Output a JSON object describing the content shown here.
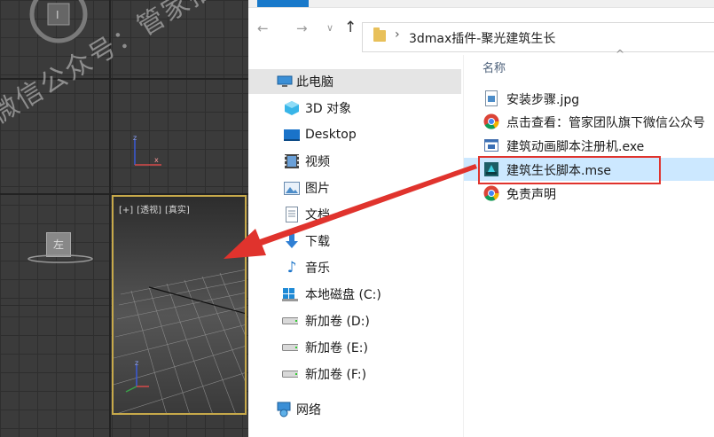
{
  "watermark": "微信公众号：管家插件",
  "viewport": {
    "label_plus": "[+]",
    "label_view": "[透视]",
    "label_shading": "[真实]",
    "cube_text": "左"
  },
  "explorer": {
    "address": {
      "back_icon": "back-arrow-icon",
      "forward_icon": "forward-arrow-icon",
      "recent_icon": "chevron-down-icon",
      "up_icon": "up-arrow-icon",
      "separator": "›",
      "path": "3dmax插件-聚光建筑生长"
    },
    "nav_items": [
      {
        "label": "此电脑",
        "icon": "computer-icon",
        "selected": true
      },
      {
        "label": "3D 对象",
        "icon": "3d-objects-icon"
      },
      {
        "label": "Desktop",
        "icon": "desktop-icon"
      },
      {
        "label": "视频",
        "icon": "video-icon"
      },
      {
        "label": "图片",
        "icon": "pictures-icon"
      },
      {
        "label": "文档",
        "icon": "documents-icon"
      },
      {
        "label": "下载",
        "icon": "download-icon"
      },
      {
        "label": "音乐",
        "icon": "music-icon"
      },
      {
        "label": "本地磁盘 (C:)",
        "icon": "windows-drive-icon"
      },
      {
        "label": "新加卷 (D:)",
        "icon": "drive-icon"
      },
      {
        "label": "新加卷 (E:)",
        "icon": "drive-icon"
      },
      {
        "label": "新加卷 (F:)",
        "icon": "drive-icon"
      },
      {
        "label": "网络",
        "icon": "network-icon"
      }
    ],
    "column_header": "名称",
    "files": [
      {
        "label": "安装步骤.jpg",
        "icon": "image-file-icon"
      },
      {
        "label": "点击查看：管家团队旗下微信公众号",
        "icon": "chrome-icon"
      },
      {
        "label": "建筑动画脚本注册机.exe",
        "icon": "exe-file-icon"
      },
      {
        "label": "建筑生长脚本.mse",
        "icon": "mse-script-icon",
        "selected": true
      },
      {
        "label": "免责声明",
        "icon": "chrome-icon"
      }
    ],
    "colors": {
      "selection": "#cce8ff",
      "highlight_border": "#e0332d",
      "accent": "#1979ca"
    }
  }
}
